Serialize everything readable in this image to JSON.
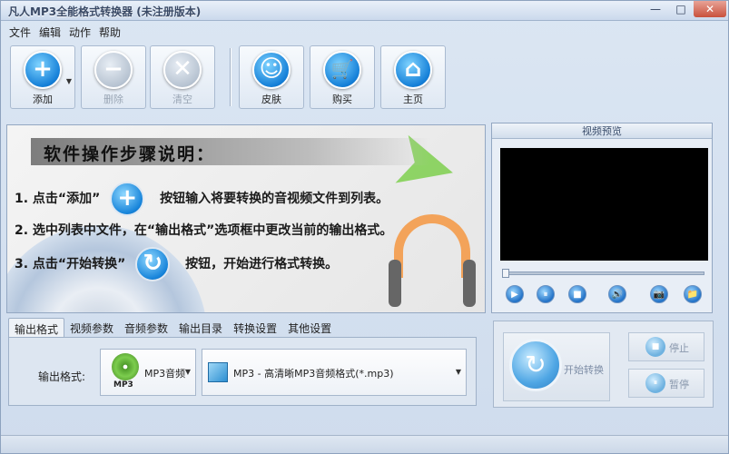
{
  "window": {
    "title": "凡人MP3全能格式转换器 (未注册版本)",
    "minimize": "—",
    "maximize": "□",
    "close": "✕"
  },
  "menu": [
    "文件",
    "编辑",
    "动作",
    "帮助"
  ],
  "toolbar": {
    "add": {
      "label": "添加",
      "icon": "+"
    },
    "delete": {
      "label": "删除",
      "icon": "−"
    },
    "clear": {
      "label": "清空",
      "icon": "✕"
    },
    "skin": {
      "label": "皮肤",
      "icon": "☺"
    },
    "buy": {
      "label": "购买",
      "icon": "🛒"
    },
    "home": {
      "label": "主页",
      "icon": "⌂"
    },
    "dropdown_caret": "▼"
  },
  "guide": {
    "heading": "软件操作步骤说明：",
    "step1_a": "1. 点击“添加”",
    "step1_b": "按钮输入将要转换的音视频文件到列表。",
    "step2": "2. 选中列表中文件，在“输出格式”选项框中更改当前的输出格式。",
    "step3_a": "3. 点击“开始转换”",
    "step3_b": "按钮，开始进行格式转换。",
    "add_icon": "+",
    "start_icon": "↻"
  },
  "preview": {
    "title": "视频预览",
    "controls": [
      "▶",
      "⏸",
      "■",
      "🔊",
      "📷",
      "📁"
    ]
  },
  "tabs": [
    "输出格式",
    "视频参数",
    "音频参数",
    "输出目录",
    "转换设置",
    "其他设置"
  ],
  "output": {
    "label": "输出格式:",
    "category": "MP3音频",
    "category_icon_text": "MP3",
    "format": "MP3 - 高清晰MP3音频格式(*.mp3)"
  },
  "convert": {
    "start_label": "开始转换",
    "stop_label": "停止",
    "pause_label": "暂停",
    "stop_icon": "■",
    "pause_icon": "⏸"
  }
}
